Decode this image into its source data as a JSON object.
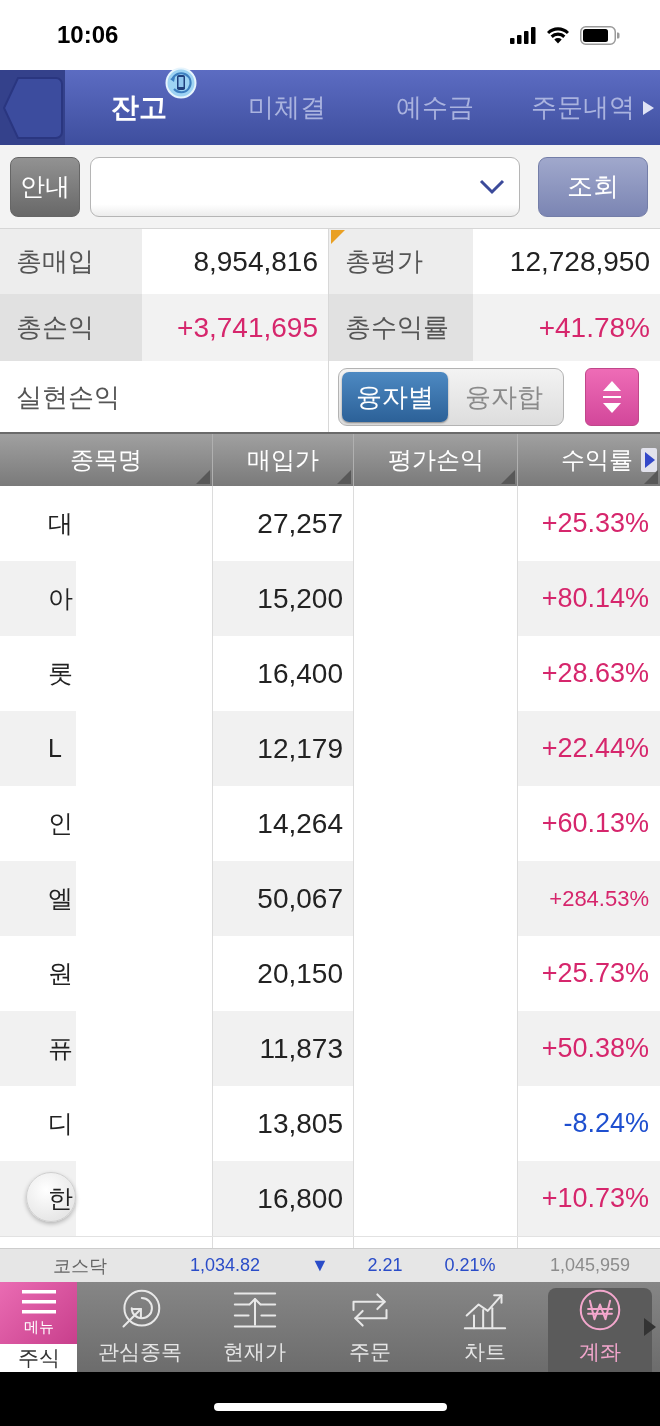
{
  "status_bar": {
    "time": "10:06"
  },
  "top_tabs": [
    {
      "label": "잔고",
      "selected": true,
      "sync_badge": true
    },
    {
      "label": "미체결",
      "selected": false,
      "sync_badge": false
    },
    {
      "label": "예수금",
      "selected": false,
      "sync_badge": false
    },
    {
      "label": "주문내역",
      "selected": false,
      "sync_badge": false
    }
  ],
  "query_bar": {
    "guide_button": "안내",
    "search_button": "조회"
  },
  "summary": [
    {
      "label": "총매입",
      "value": "8,954,816",
      "color": "#222222",
      "marked": false
    },
    {
      "label": "총평가",
      "value": "12,728,950",
      "color": "#222222",
      "marked": true
    },
    {
      "label": "총손익",
      "value": "+3,741,695",
      "color": "#d6266c",
      "marked": false
    },
    {
      "label": "총수익률",
      "value": "+41.78%",
      "color": "#d6266c",
      "marked": false
    },
    {
      "label": "실현손익",
      "marked": false
    }
  ],
  "loan_toggle": [
    {
      "label": "융자별",
      "selected": true
    },
    {
      "label": "융자합",
      "selected": false
    }
  ],
  "holdings": {
    "columns": [
      {
        "label": "종목명"
      },
      {
        "label": "매입가"
      },
      {
        "label": "평가손익"
      },
      {
        "label": "수익률"
      }
    ],
    "rows": [
      {
        "name": "대",
        "price": "27,257",
        "rate": "+25.33%",
        "color": "#d6266c"
      },
      {
        "name": "아",
        "price": "15,200",
        "rate": "+80.14%",
        "color": "#d6266c"
      },
      {
        "name": "롯",
        "price": "16,400",
        "rate": "+28.63%",
        "color": "#d6266c"
      },
      {
        "name": "L",
        "price": "12,179",
        "rate": "+22.44%",
        "color": "#d6266c"
      },
      {
        "name": "인",
        "price": "14,264",
        "rate": "+60.13%",
        "color": "#d6266c"
      },
      {
        "name": "엘",
        "price": "50,067",
        "rate": "+284.53%",
        "color": "#d6266c"
      },
      {
        "name": "원",
        "price": "20,150",
        "rate": "+25.73%",
        "color": "#d6266c"
      },
      {
        "name": "퓨",
        "price": "11,873",
        "rate": "+50.38%",
        "color": "#d6266c"
      },
      {
        "name": "디",
        "price": "13,805",
        "rate": "-8.24%",
        "color": "#1e4fcf"
      },
      {
        "name": "한",
        "price": "16,800",
        "rate": "+10.73%",
        "color": "#d6266c"
      }
    ]
  },
  "index_ticker": {
    "name": "코스닥",
    "value": "1,034.82",
    "arrow": "▼",
    "change": "2.21",
    "rate": "0.21%",
    "volume": "1,045,959",
    "color": "#2a4cc8"
  },
  "bottom_nav": {
    "menu": "메뉴",
    "market": "주식",
    "items": [
      {
        "label": "관심종목",
        "selected": false
      },
      {
        "label": "현재가",
        "selected": false
      },
      {
        "label": "주문",
        "selected": false
      },
      {
        "label": "차트",
        "selected": false
      },
      {
        "label": "계좌",
        "selected": true
      }
    ]
  }
}
